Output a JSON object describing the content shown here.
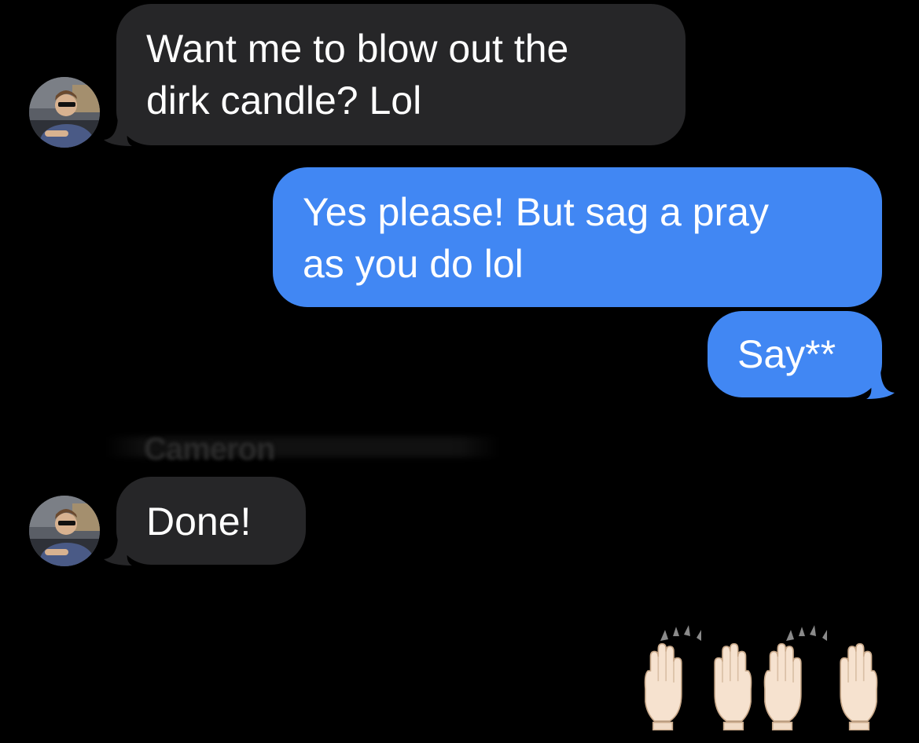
{
  "conversation": {
    "messages": [
      {
        "direction": "incoming",
        "lines": [
          "Want me to blow out the",
          "dirk candle? Lol"
        ]
      },
      {
        "direction": "outgoing",
        "lines": [
          "Yes please! But sag a pray",
          "as you do lol"
        ]
      },
      {
        "direction": "outgoing",
        "lines": [
          "Say**"
        ]
      },
      {
        "direction": "incoming",
        "lines": [
          "Done!"
        ]
      },
      {
        "direction": "outgoing",
        "emoji": "🙌🙌"
      }
    ],
    "sender_name_obscured": "Cameron"
  },
  "colors": {
    "background": "#000000",
    "incoming_bubble": "#262628",
    "outgoing_bubble": "#4187f3",
    "text": "#ffffff"
  },
  "icons": {
    "contact_avatar": "contact-photo",
    "emoji": "raising-hands"
  }
}
